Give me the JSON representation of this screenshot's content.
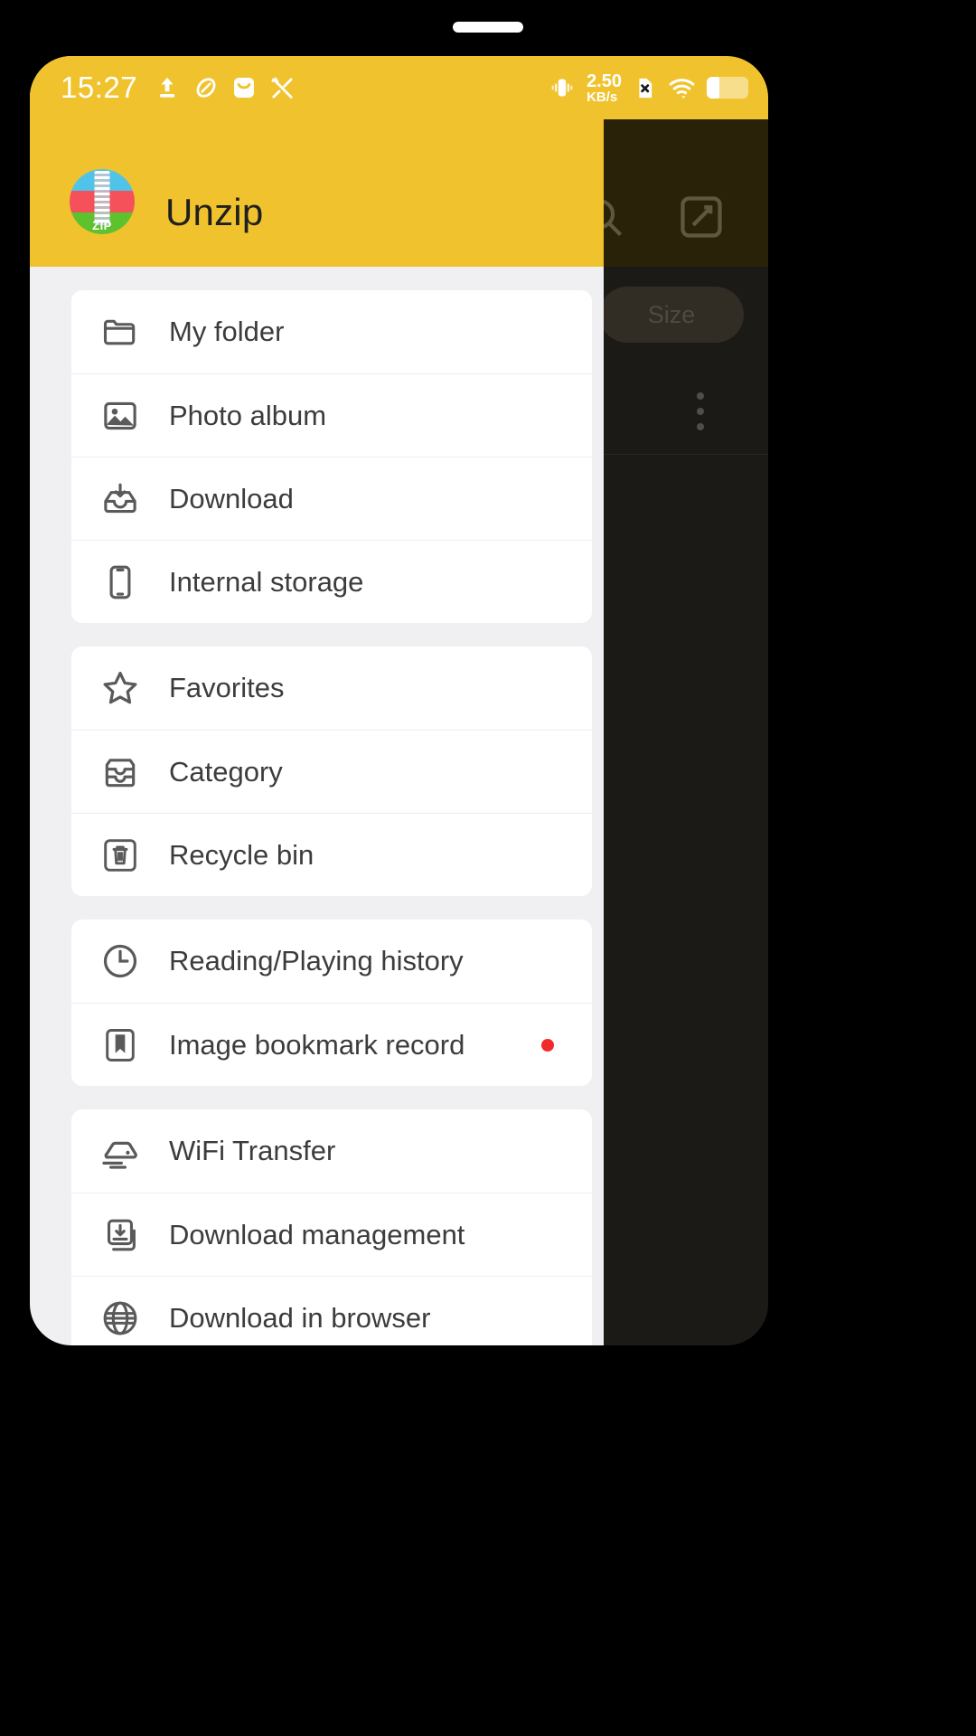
{
  "theme": {
    "accent": "#F0C32E",
    "drawer_bg": "#F0F0F3",
    "card_bg": "#FFFFFF",
    "icon_color": "#5A5A5A",
    "label_color": "#3C3C3C",
    "badge_color": "#EF2B2B",
    "dim_overlay": "#1C1A16"
  },
  "statusbar": {
    "clock": "15:27",
    "left_icons": [
      "upload-arrow-icon",
      "leaf-oval-icon",
      "mail-app-icon",
      "tools-icon"
    ],
    "network_speed_value": "2.50",
    "network_speed_unit": "KB/s",
    "right_icons": [
      "vibrate-icon",
      "sim-card-disabled-icon",
      "wifi-icon",
      "battery-icon"
    ]
  },
  "header": {
    "app_icon": "zip-app-icon",
    "app_icon_text": "ZIP",
    "title": "Unzip"
  },
  "dim_panel": {
    "search_icon": "search-icon",
    "edit_icon": "edit-square-icon",
    "size_chip_label": "Size",
    "kebab_icon": "more-vertical-icon"
  },
  "drawer": {
    "groups": [
      {
        "items": [
          {
            "icon": "folder-icon",
            "label": "My folder",
            "badge": false
          },
          {
            "icon": "image-icon",
            "label": "Photo album",
            "badge": false
          },
          {
            "icon": "download-tray-icon",
            "label": "Download",
            "badge": false
          },
          {
            "icon": "phone-icon",
            "label": "Internal storage",
            "badge": false
          }
        ]
      },
      {
        "items": [
          {
            "icon": "star-icon",
            "label": "Favorites",
            "badge": false
          },
          {
            "icon": "category-drawer-icon",
            "label": "Category",
            "badge": false
          },
          {
            "icon": "trash-icon",
            "label": "Recycle bin",
            "badge": false
          }
        ]
      },
      {
        "items": [
          {
            "icon": "clock-icon",
            "label": "Reading/Playing history",
            "badge": false
          },
          {
            "icon": "bookmark-icon",
            "label": "Image bookmark record",
            "badge": true
          }
        ]
      },
      {
        "items": [
          {
            "icon": "wifi-transfer-icon",
            "label": "WiFi Transfer",
            "badge": false
          },
          {
            "icon": "download-manage-icon",
            "label": "Download management",
            "badge": false
          },
          {
            "icon": "globe-icon",
            "label": "Download in browser",
            "badge": false
          }
        ]
      }
    ]
  }
}
